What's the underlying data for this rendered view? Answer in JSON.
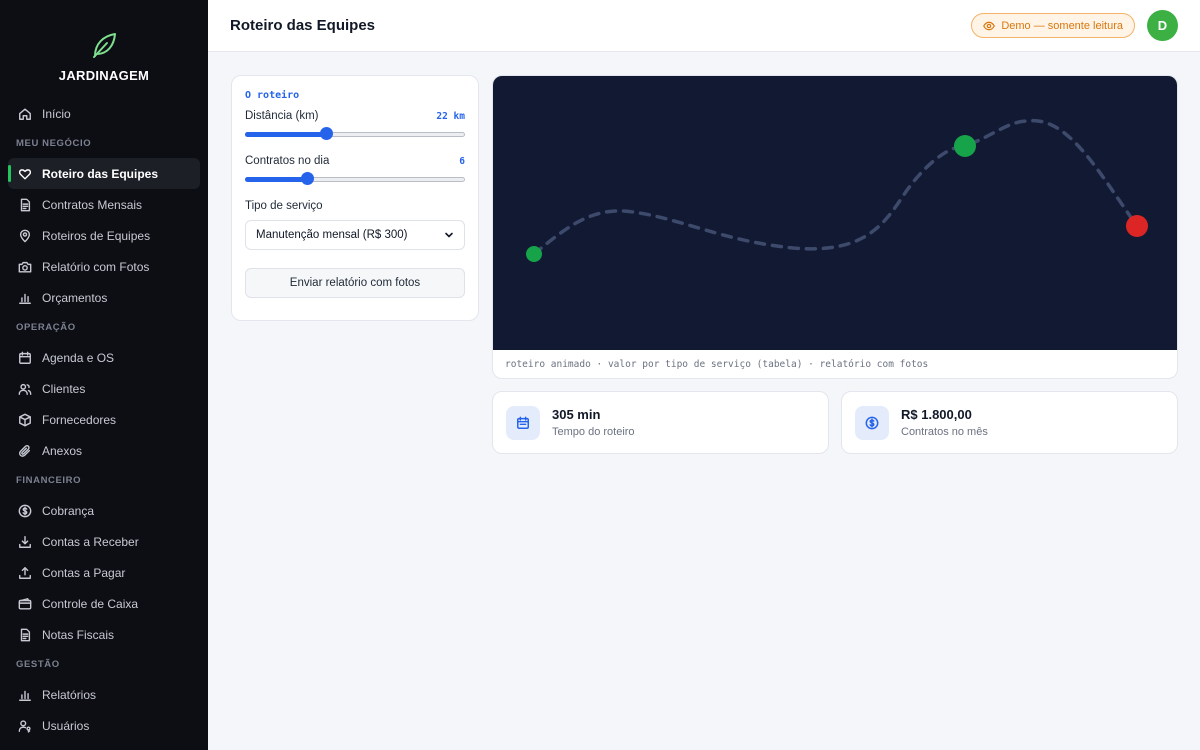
{
  "brand": {
    "name": "JARDINAGEM",
    "logo_icon": "leaf-icon",
    "accent": "#22c55e"
  },
  "sidebar": {
    "top_items": [
      {
        "label": "Início",
        "icon": "home-icon"
      }
    ],
    "sections": [
      {
        "title": "MEU NEGÓCIO",
        "items": [
          {
            "label": "Roteiro das Equipes",
            "icon": "heart-icon",
            "active": true
          },
          {
            "label": "Contratos Mensais",
            "icon": "document-icon"
          },
          {
            "label": "Roteiros de Equipes",
            "icon": "map-pin-icon"
          },
          {
            "label": "Relatório com Fotos",
            "icon": "camera-icon"
          },
          {
            "label": "Orçamentos",
            "icon": "bar-chart-icon"
          }
        ]
      },
      {
        "title": "OPERAÇÃO",
        "items": [
          {
            "label": "Agenda e OS",
            "icon": "calendar-icon"
          },
          {
            "label": "Clientes",
            "icon": "users-icon"
          },
          {
            "label": "Fornecedores",
            "icon": "box-icon"
          },
          {
            "label": "Anexos",
            "icon": "paperclip-icon"
          }
        ]
      },
      {
        "title": "FINANCEIRO",
        "items": [
          {
            "label": "Cobrança",
            "icon": "dollar-circle-icon"
          },
          {
            "label": "Contas a Receber",
            "icon": "download-icon"
          },
          {
            "label": "Contas a Pagar",
            "icon": "upload-icon"
          },
          {
            "label": "Controle de Caixa",
            "icon": "wallet-icon"
          },
          {
            "label": "Notas Fiscais",
            "icon": "receipt-icon"
          }
        ]
      },
      {
        "title": "GESTÃO",
        "items": [
          {
            "label": "Relatórios",
            "icon": "bar-chart-icon"
          },
          {
            "label": "Usuários",
            "icon": "user-key-icon"
          }
        ]
      }
    ]
  },
  "header": {
    "title": "Roteiro das Equipes",
    "demo_badge": "Demo — somente leitura",
    "avatar_initial": "D",
    "avatar_color": "#3cb043"
  },
  "panel": {
    "title": "O roteiro",
    "distance": {
      "label": "Distância (km)",
      "value_text": "22 km",
      "value": 22,
      "fraction": 0.37
    },
    "contracts": {
      "label": "Contratos no dia",
      "value_text": "6",
      "value": 6,
      "fraction": 0.28
    },
    "service_type": {
      "label": "Tipo de serviço",
      "selected": "Manutenção mensal (R$ 300)"
    },
    "send_button": "Enviar relatório com fotos"
  },
  "route": {
    "caption": "roteiro animado · valor por tipo de serviço (tabela) · relatório com fotos",
    "background": "#121a33",
    "start_color": "#16a34a",
    "current_color": "#16a34a",
    "end_color": "#dc2626"
  },
  "stats": [
    {
      "value": "305 min",
      "label": "Tempo do roteiro",
      "icon": "calendar-icon"
    },
    {
      "value": "R$ 1.800,00",
      "label": "Contratos no mês",
      "icon": "dollar-circle-icon"
    }
  ]
}
